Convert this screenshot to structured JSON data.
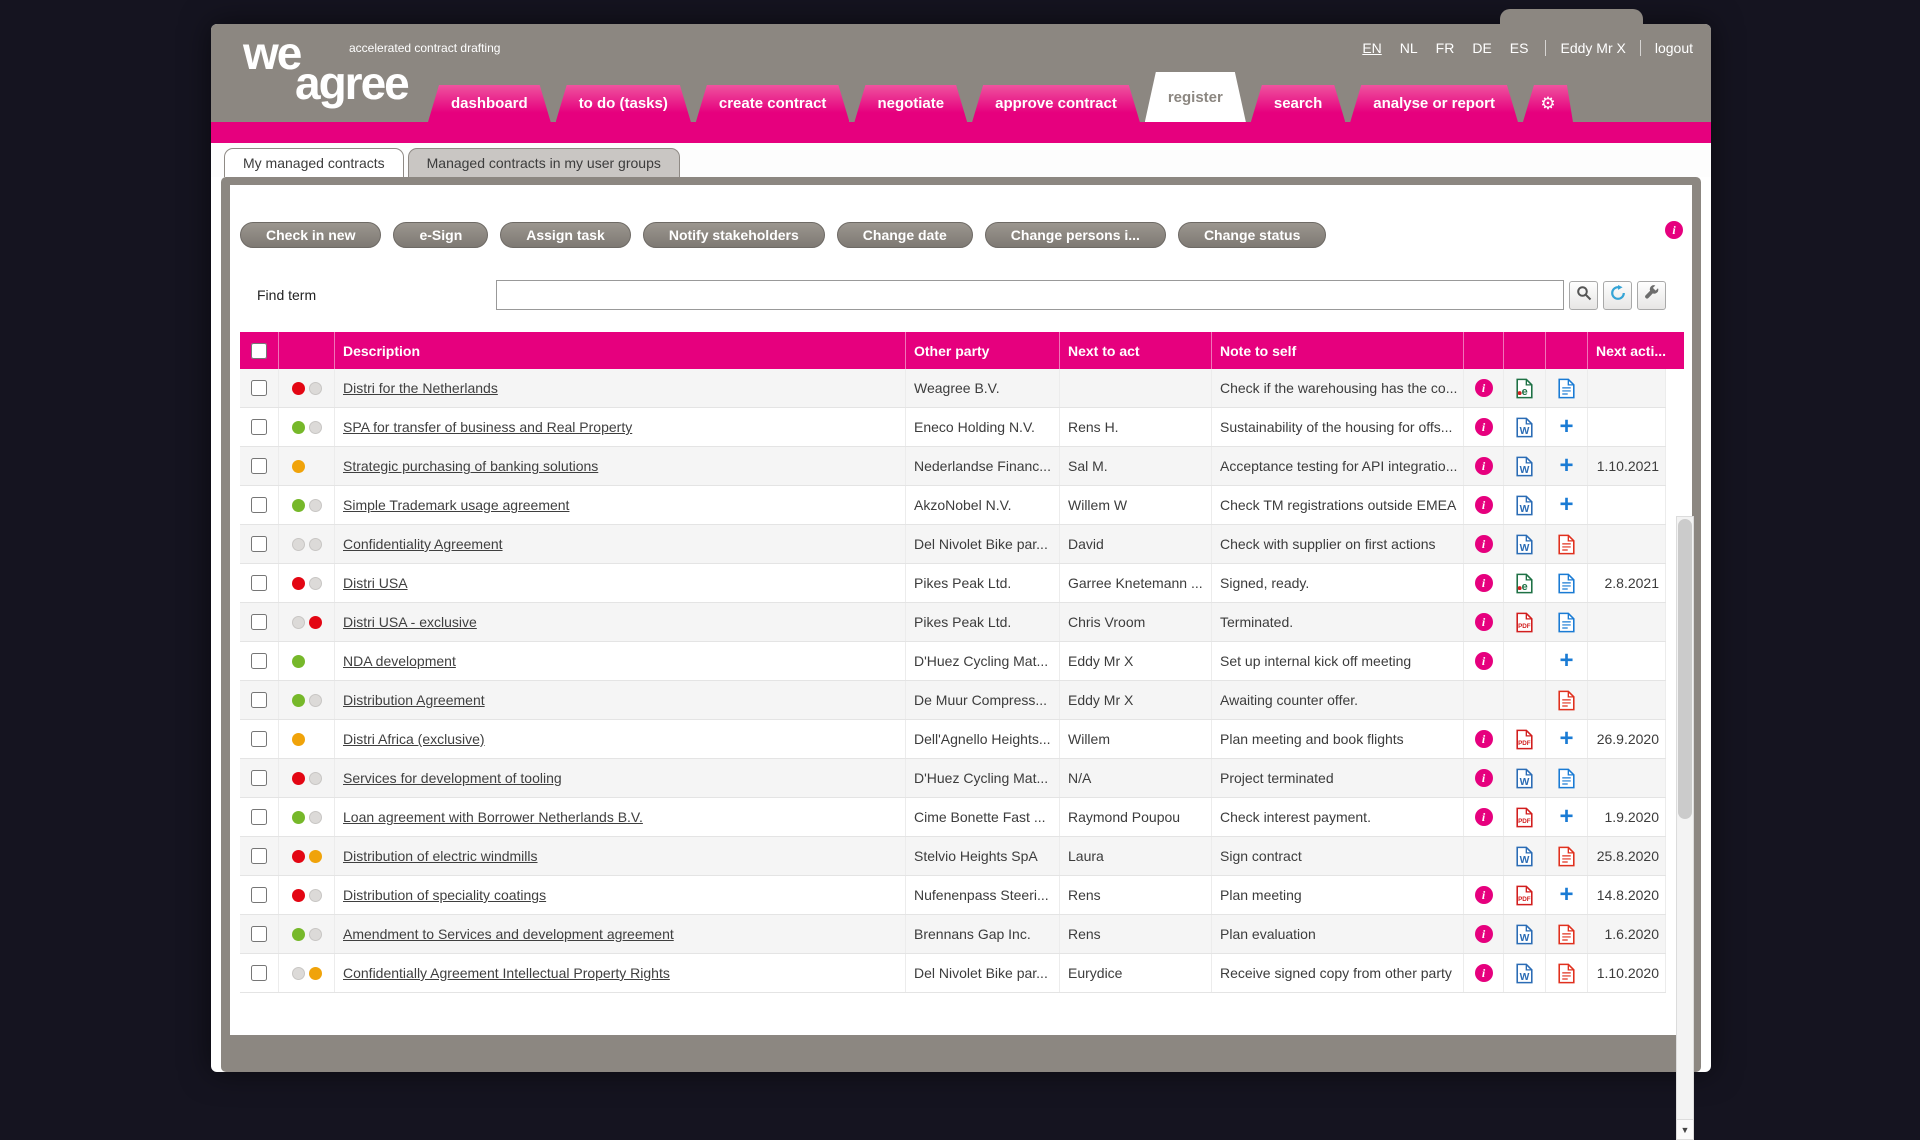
{
  "colors": {
    "magenta": "#e6007e",
    "header_gray": "#8c8781",
    "page_bg": "#151420",
    "dot_red": "#e30613",
    "dot_green": "#76b82a",
    "dot_orange": "#f0a30a",
    "word_blue": "#2b6cb5",
    "pdf_red": "#d21e1e",
    "plus_blue": "#1a7bd4"
  },
  "icons": {
    "gear": "⚙",
    "scroll_down": "▼",
    "info": "i",
    "plus": "+"
  },
  "header": {
    "logo": {
      "we": "we",
      "agree": "agree",
      "tagline": "accelerated contract drafting"
    },
    "languages": [
      "EN",
      "NL",
      "FR",
      "DE",
      "ES"
    ],
    "active_language": "EN",
    "user": "Eddy Mr X",
    "logout_label": "logout"
  },
  "nav": {
    "tabs": [
      {
        "label": "dashboard",
        "active": false
      },
      {
        "label": "to do (tasks)",
        "active": false
      },
      {
        "label": "create contract",
        "active": false
      },
      {
        "label": "negotiate",
        "active": false
      },
      {
        "label": "approve contract",
        "active": false
      },
      {
        "label": "register",
        "active": true
      },
      {
        "label": "search",
        "active": false
      },
      {
        "label": "analyse or report",
        "active": false
      }
    ]
  },
  "subtabs": [
    {
      "label": "My managed contracts",
      "active": true
    },
    {
      "label": "Managed contracts in my user groups",
      "active": false
    }
  ],
  "toolbar": {
    "buttons": [
      "Check in new",
      "e-Sign",
      "Assign task",
      "Notify stakeholders",
      "Change date",
      "Change persons i...",
      "Change status"
    ]
  },
  "search": {
    "label": "Find term",
    "value": ""
  },
  "table": {
    "columns": {
      "description": "Description",
      "other_party": "Other party",
      "next_to_act": "Next to act",
      "note_to_self": "Note to self",
      "next_action": "Next acti..."
    },
    "rows": [
      {
        "description": "Distri for the Netherlands",
        "other_party": "Weagree B.V.",
        "next_to_act": "",
        "note_to_self": "Check if the warehousing has the co...",
        "next_action": "",
        "dot1": "red",
        "dot2": "gray",
        "info": true,
        "doc": "excel",
        "action": "doc-blue"
      },
      {
        "description": "SPA for transfer of business and Real Property",
        "other_party": "Eneco Holding N.V.",
        "next_to_act": "Rens H.",
        "note_to_self": "Sustainability of the housing for offs...",
        "next_action": "",
        "dot1": "green",
        "dot2": "gray",
        "info": true,
        "doc": "word",
        "action": "plus"
      },
      {
        "description": "Strategic purchasing of banking solutions",
        "other_party": "Nederlandse Financ...",
        "next_to_act": "Sal M.",
        "note_to_self": "Acceptance testing for API integratio...",
        "next_action": "1.10.2021",
        "dot1": "orange",
        "dot2": "none",
        "info": true,
        "doc": "word",
        "action": "plus"
      },
      {
        "description": "Simple Trademark usage agreement",
        "other_party": "AkzoNobel N.V.",
        "next_to_act": "Willem W",
        "note_to_self": "Check TM registrations outside EMEA",
        "next_action": "",
        "dot1": "green",
        "dot2": "gray",
        "info": true,
        "doc": "word",
        "action": "plus"
      },
      {
        "description": "Confidentiality Agreement",
        "other_party": "Del Nivolet Bike par...",
        "next_to_act": "David",
        "note_to_self": "Check with supplier on first actions",
        "next_action": "",
        "dot1": "gray",
        "dot2": "gray",
        "info": true,
        "doc": "word",
        "action": "doc-red"
      },
      {
        "description": "Distri USA",
        "other_party": "Pikes Peak Ltd.",
        "next_to_act": "Garree Knetemann ...",
        "note_to_self": "Signed, ready.",
        "next_action": "2.8.2021",
        "dot1": "red",
        "dot2": "gray",
        "info": true,
        "doc": "excel",
        "action": "doc-blue"
      },
      {
        "description": "Distri USA - exclusive",
        "other_party": "Pikes Peak Ltd.",
        "next_to_act": "Chris Vroom",
        "note_to_self": "Terminated.",
        "next_action": "",
        "dot1": "gray",
        "dot2": "red",
        "info": true,
        "doc": "pdf",
        "action": "doc-blue"
      },
      {
        "description": "NDA development",
        "other_party": "D'Huez Cycling Mat...",
        "next_to_act": "Eddy Mr X",
        "note_to_self": "Set up internal kick off meeting",
        "next_action": "",
        "dot1": "green",
        "dot2": "none",
        "info": true,
        "doc": "none",
        "action": "plus"
      },
      {
        "description": "Distribution Agreement",
        "other_party": "De Muur Compress...",
        "next_to_act": "Eddy Mr X",
        "note_to_self": "Awaiting counter offer.",
        "next_action": "",
        "dot1": "green",
        "dot2": "gray",
        "info": false,
        "doc": "none",
        "action": "doc-red"
      },
      {
        "description": "Distri Africa (exclusive)",
        "other_party": "Dell'Agnello Heights...",
        "next_to_act": "Willem",
        "note_to_self": "Plan meeting and book flights",
        "next_action": "26.9.2020",
        "dot1": "orange",
        "dot2": "none",
        "info": true,
        "doc": "pdf",
        "action": "plus"
      },
      {
        "description": "Services for development of tooling",
        "other_party": "D'Huez Cycling Mat...",
        "next_to_act": "N/A",
        "note_to_self": "Project terminated",
        "next_action": "",
        "dot1": "red",
        "dot2": "gray",
        "info": true,
        "doc": "word",
        "action": "doc-blue"
      },
      {
        "description": "Loan agreement with Borrower Netherlands B.V.",
        "other_party": "Cime Bonette Fast ...",
        "next_to_act": "Raymond Poupou",
        "note_to_self": "Check interest payment.",
        "next_action": "1.9.2020",
        "dot1": "green",
        "dot2": "gray",
        "info": true,
        "doc": "pdf",
        "action": "plus"
      },
      {
        "description": "Distribution of electric windmills",
        "other_party": "Stelvio Heights SpA",
        "next_to_act": "Laura",
        "note_to_self": "Sign contract",
        "next_action": "25.8.2020",
        "dot1": "red",
        "dot2": "orange",
        "info": false,
        "doc": "word",
        "action": "doc-red"
      },
      {
        "description": "Distribution of speciality coatings",
        "other_party": "Nufenenpass Steeri...",
        "next_to_act": "Rens",
        "note_to_self": "Plan meeting",
        "next_action": "14.8.2020",
        "dot1": "red",
        "dot2": "gray",
        "info": true,
        "doc": "pdf",
        "action": "plus"
      },
      {
        "description": "Amendment to Services and development agreement",
        "other_party": "Brennans Gap Inc.",
        "next_to_act": "Rens",
        "note_to_self": "Plan evaluation",
        "next_action": "1.6.2020",
        "dot1": "green",
        "dot2": "gray",
        "info": true,
        "doc": "word",
        "action": "doc-red"
      },
      {
        "description": "Confidentially Agreement Intellectual Property Rights",
        "other_party": "Del Nivolet Bike par...",
        "next_to_act": "Eurydice",
        "note_to_self": "Receive signed copy from other party",
        "next_action": "1.10.2020",
        "dot1": "gray",
        "dot2": "orange",
        "info": true,
        "doc": "word",
        "action": "doc-red"
      }
    ]
  }
}
